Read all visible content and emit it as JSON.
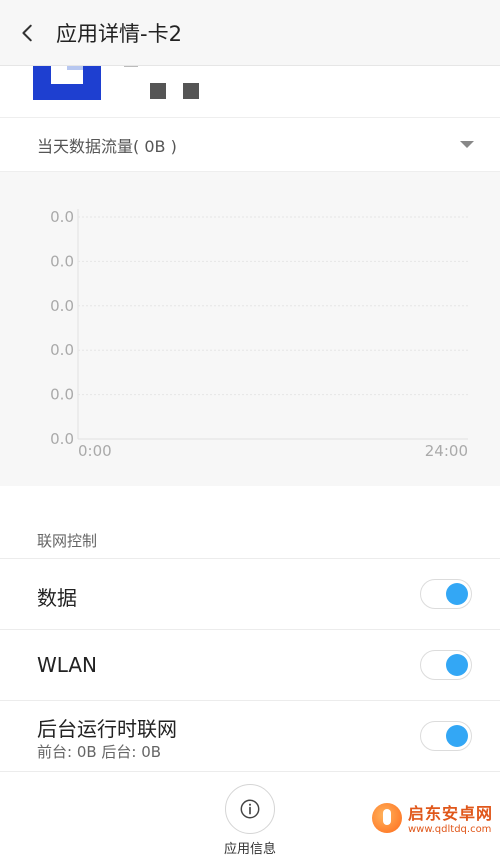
{
  "header": {
    "title": "应用详情-卡2"
  },
  "usage": {
    "label": "当天数据流量( 0B )"
  },
  "chart_data": {
    "type": "line",
    "y_tick_labels": [
      "0.0",
      "0.0",
      "0.0",
      "0.0",
      "0.0",
      "0.0"
    ],
    "x_tick_labels": [
      "0:00",
      "24:00"
    ],
    "x": [],
    "values": [],
    "grid": true
  },
  "network": {
    "section_title": "联网控制",
    "rows": [
      {
        "label": "数据",
        "sub": "",
        "enabled": true
      },
      {
        "label": "WLAN",
        "sub": "",
        "enabled": true
      },
      {
        "label": "后台运行时联网",
        "sub": "前台: 0B  后台: 0B",
        "enabled": true
      }
    ]
  },
  "bottom": {
    "info_label": "应用信息"
  },
  "watermark": {
    "title": "启东安卓网",
    "url": "www.qdltdq.com"
  },
  "colors": {
    "accent": "#33a7f5",
    "app_icon": "#1e3fd0"
  }
}
